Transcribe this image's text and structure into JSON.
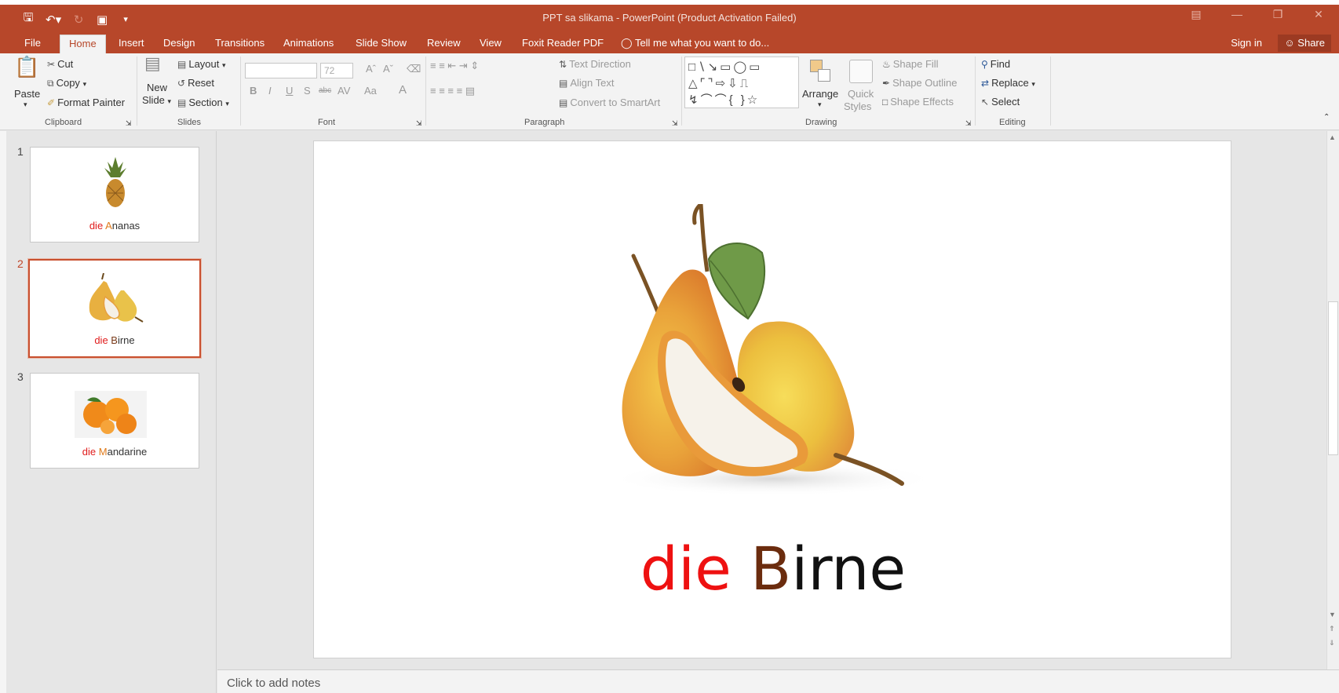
{
  "app": {
    "title": "PPT sa slikama - PowerPoint (Product Activation Failed)",
    "accent": "#b7472a"
  },
  "quick_access": {
    "save_icon": "save-icon",
    "undo_icon": "undo-icon",
    "redo_icon": "redo-icon",
    "present_icon": "start-presentation-icon",
    "customize_icon": "customize-toolbar-icon"
  },
  "tabs": [
    {
      "label": "File"
    },
    {
      "label": "Home"
    },
    {
      "label": "Insert"
    },
    {
      "label": "Design"
    },
    {
      "label": "Transitions"
    },
    {
      "label": "Animations"
    },
    {
      "label": "Slide Show"
    },
    {
      "label": "Review"
    },
    {
      "label": "View"
    },
    {
      "label": "Foxit Reader PDF"
    },
    {
      "label": "Tell me what you want to do..."
    }
  ],
  "account": {
    "signin": "Sign in",
    "share": "Share"
  },
  "ribbon": {
    "clipboard": {
      "paste": "Paste",
      "cut": "Cut",
      "copy": "Copy",
      "format_painter": "Format Painter",
      "group": "Clipboard"
    },
    "slides": {
      "new_slide_1": "New",
      "new_slide_2": "Slide",
      "layout": "Layout",
      "reset": "Reset",
      "section": "Section",
      "group": "Slides"
    },
    "font": {
      "size": "72",
      "bold": "B",
      "italic": "I",
      "underline": "U",
      "shadow": "S",
      "strike": "abc",
      "spacing": "AV",
      "case": "Aa",
      "color": "A",
      "group": "Font"
    },
    "paragraph": {
      "text_direction": "Text Direction",
      "align_text": "Align Text",
      "smartart": "Convert to SmartArt",
      "group": "Paragraph"
    },
    "drawing": {
      "arrange": "Arrange",
      "quick_1": "Quick",
      "quick_2": "Styles",
      "shape_fill": "Shape Fill",
      "shape_outline": "Shape Outline",
      "shape_effects": "Shape Effects",
      "group": "Drawing"
    },
    "editing": {
      "find": "Find",
      "replace": "Replace",
      "select": "Select",
      "group": "Editing"
    }
  },
  "slides": [
    {
      "num": "1",
      "article": "die ",
      "initial": "A",
      "rest": "nanas"
    },
    {
      "num": "2",
      "article": "die ",
      "initial": "B",
      "rest": "irne"
    },
    {
      "num": "3",
      "article": "die ",
      "initial": "M",
      "rest": "andarine"
    }
  ],
  "current_slide": {
    "w1": "die",
    "w2": "B",
    "w3": "irne"
  },
  "notes": {
    "placeholder": "Click to add notes"
  }
}
